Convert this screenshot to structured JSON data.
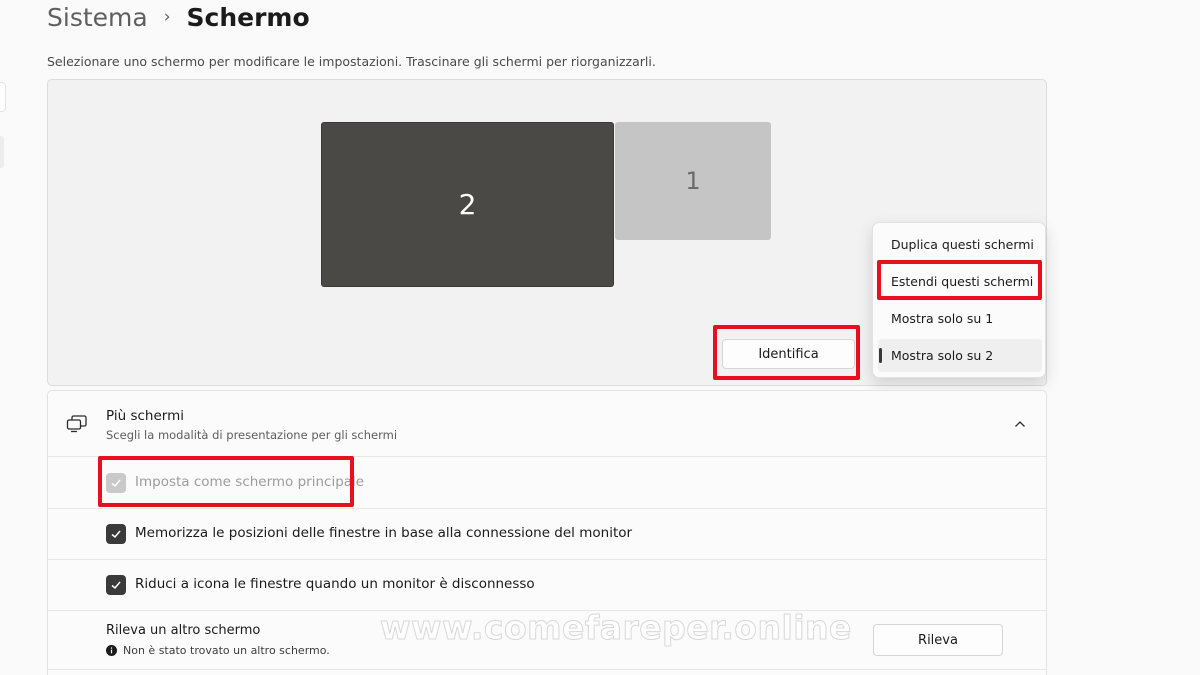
{
  "breadcrumb": {
    "parent": "Sistema",
    "separator": "›",
    "current": "Schermo"
  },
  "instruction": "Selezionare uno schermo per modificare le impostazioni. Trascinare gli schermi per riorganizzarli.",
  "displays": {
    "monitor_2_label": "2",
    "monitor_1_label": "1"
  },
  "identify_button": "Identifica",
  "projection_menu": {
    "items": [
      "Duplica questi schermi",
      "Estendi questi schermi",
      "Mostra solo su 1",
      "Mostra solo su 2"
    ],
    "selected_index": 3
  },
  "multiple_displays": {
    "title": "Più schermi",
    "subtitle": "Scegli la modalità di presentazione per gli schermi",
    "options": [
      {
        "label": "Imposta come schermo principale",
        "checked": true,
        "disabled": true
      },
      {
        "label": "Memorizza le posizioni delle finestre in base alla connessione del monitor",
        "checked": true,
        "disabled": false
      },
      {
        "label": "Riduci a icona le finestre quando un monitor è disconnesso",
        "checked": true,
        "disabled": false
      }
    ],
    "detect": {
      "title": "Rileva un altro schermo",
      "status": "Non è stato trovato un altro schermo.",
      "button": "Rileva"
    }
  },
  "watermark": "www.comefareper.online",
  "colors": {
    "annotation_red": "#e8101f",
    "monitor_active": "#4a4945",
    "monitor_inactive": "#c5c5c5",
    "checkbox_on": "#3a3a3a"
  },
  "icons": {
    "header": "multiple-displays-icon",
    "collapse": "chevron-up-icon",
    "status": "info-icon",
    "check": "checkmark-icon"
  }
}
